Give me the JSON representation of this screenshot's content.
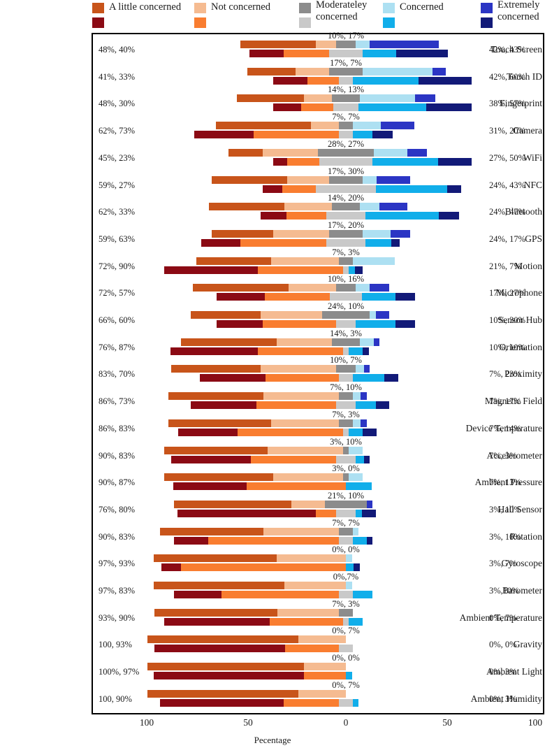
{
  "axis": {
    "xlabel": "Pecentage",
    "ticks": [
      "100",
      "50",
      "0",
      "50",
      "100"
    ]
  },
  "legend": {
    "items": [
      {
        "label": "A little concerned",
        "color_top": "#c8541a",
        "color_bottom": "#8b0a14"
      },
      {
        "label": "Not concerned",
        "color_top": "#f5bb91",
        "color_bottom": "#f97d30"
      },
      {
        "label": "Moderateley concerned",
        "color_top": "#8c8c8c",
        "color_bottom": "#c9c9c9"
      },
      {
        "label": "Concerned",
        "color_top": "#ade0f2",
        "color_bottom": "#11aeea"
      },
      {
        "label": "Extremely concerned",
        "color_top": "#2b35c4",
        "color_bottom": "#121a78"
      }
    ]
  },
  "chart_data": {
    "type": "bar",
    "title": "",
    "xlabel": "Pecentage",
    "ylabel": "",
    "xlim": [
      -100,
      100
    ],
    "grid": false,
    "legend_position": "top",
    "note": "Diverging stacked bars. Each category has two bars (series A = top, series B = bottom). Left label = sum of 'A little concerned' + 'Not concerned' for both series. Right label = sum of 'Concerned' + 'Extremely concerned' for both series. Center label above each pair = 'Moderateley concerned' for both series.",
    "series_names": [
      "Series A (top bar)",
      "Series B (bottom bar)"
    ],
    "segments": [
      "A little concerned",
      "Not concerned",
      "Moderateley concerned",
      "Concerned",
      "Extremely concerned"
    ],
    "categories": [
      "Touch Screen",
      "Touch ID",
      "Fingerprint",
      "Camera",
      "WiFi",
      "NFC",
      "Bluetooth",
      "GPS",
      "Motion",
      "Microphone",
      "Sensor  Hub",
      "Orientation",
      "Proximity",
      "Magnetic Field",
      "Device  Temperature",
      "Accelerometer",
      "Ambient Pressure",
      "Hall Sensor",
      "Rotation",
      "Gyroscope",
      "Barometer",
      "Ambient Temperature",
      "Gravity",
      "Ambient Light",
      "Ambient Humidity"
    ],
    "rows": [
      {
        "name": "Touch Screen",
        "left": "48%, 40%",
        "mid": "10%, 17%",
        "right": "42%, 43%",
        "a": [
          38,
          10,
          10,
          7,
          35
        ],
        "b": [
          17,
          23,
          17,
          17,
          26
        ]
      },
      {
        "name": "Touch ID",
        "left": "41%, 33%",
        "mid": "17%, 7%",
        "right": "42%, 60%",
        "a": [
          24,
          17,
          17,
          35,
          7
        ],
        "b": [
          17,
          16,
          7,
          33,
          27
        ]
      },
      {
        "name": "Fingerprint",
        "left": "48%, 30%",
        "mid": "14%, 13%",
        "right": "38%, 57%",
        "a": [
          34,
          14,
          14,
          28,
          10
        ],
        "b": [
          14,
          16,
          13,
          34,
          23
        ]
      },
      {
        "name": "Camera",
        "left": "62%, 73%",
        "mid": "7%, 7%",
        "right": "31%, 20%",
        "a": [
          48,
          14,
          7,
          14,
          17
        ],
        "b": [
          30,
          43,
          7,
          10,
          10
        ]
      },
      {
        "name": "WiFi",
        "left": "45%, 23%",
        "mid": "28%, 27%",
        "right": "27%, 50%",
        "a": [
          17,
          28,
          28,
          17,
          10
        ],
        "b": [
          7,
          16,
          27,
          33,
          17
        ]
      },
      {
        "name": "NFC",
        "left": "59%, 27%",
        "mid": "17%, 30%",
        "right": "24%, 43%",
        "a": [
          38,
          21,
          17,
          7,
          17
        ],
        "b": [
          10,
          17,
          30,
          36,
          7
        ]
      },
      {
        "name": "Bluetooth",
        "left": "62%, 33%",
        "mid": "14%, 20%",
        "right": "24%, 47%",
        "a": [
          38,
          24,
          14,
          10,
          14
        ],
        "b": [
          13,
          20,
          20,
          37,
          10
        ]
      },
      {
        "name": "GPS",
        "left": "59%, 63%",
        "mid": "17%, 20%",
        "right": "24%, 17%",
        "a": [
          31,
          28,
          17,
          14,
          10
        ],
        "b": [
          20,
          43,
          20,
          13,
          4
        ]
      },
      {
        "name": "Motion",
        "left": "72%, 90%",
        "mid": "7%, 3%",
        "right": "21%, 7%",
        "a": [
          38,
          34,
          7,
          21,
          0
        ],
        "b": [
          47,
          43,
          3,
          3,
          4
        ]
      },
      {
        "name": "Microphone",
        "left": "72%, 57%",
        "mid": "10%, 16%",
        "right": "17%, 27%",
        "a": [
          48,
          24,
          10,
          7,
          10
        ],
        "b": [
          24,
          33,
          16,
          17,
          10
        ]
      },
      {
        "name": "Sensor  Hub",
        "left": "66%, 60%",
        "mid": "24%, 10%",
        "right": "10%, 30%",
        "a": [
          35,
          31,
          24,
          3,
          7
        ],
        "b": [
          23,
          37,
          10,
          20,
          10
        ]
      },
      {
        "name": "Orientation",
        "left": "76%, 87%",
        "mid": "14%, 3%",
        "right": "10%, 10%",
        "a": [
          48,
          28,
          14,
          7,
          3
        ],
        "b": [
          44,
          43,
          3,
          7,
          3
        ]
      },
      {
        "name": "Proximity",
        "left": "83%, 70%",
        "mid": "10%, 7%",
        "right": "7%, 23%",
        "a": [
          45,
          38,
          10,
          4,
          3
        ],
        "b": [
          33,
          37,
          7,
          16,
          7
        ]
      },
      {
        "name": "Magnetic Field",
        "left": "86%, 73%",
        "mid": "7%, 10%",
        "right": "7%, 17%",
        "a": [
          48,
          38,
          7,
          4,
          3
        ],
        "b": [
          33,
          40,
          10,
          10,
          7
        ]
      },
      {
        "name": "Device  Temperature",
        "left": "86%, 83%",
        "mid": "7%, 3%",
        "right": "7%, 14%",
        "a": [
          52,
          34,
          7,
          4,
          3
        ],
        "b": [
          30,
          53,
          3,
          7,
          7
        ]
      },
      {
        "name": "Accelerometer",
        "left": "90%, 83%",
        "mid": "3%, 10%",
        "right": "7%, 3%",
        "a": [
          52,
          38,
          3,
          7,
          0
        ],
        "b": [
          40,
          43,
          10,
          4,
          3
        ]
      },
      {
        "name": "Ambient Pressure",
        "left": "90%, 87%",
        "mid": "3%, 0%",
        "right": "7%, 13%",
        "a": [
          55,
          35,
          3,
          7,
          0
        ],
        "b": [
          37,
          50,
          0,
          13,
          0
        ]
      },
      {
        "name": "Hall Sensor",
        "left": "76%, 80%",
        "mid": "21%, 10%",
        "right": "3%, 10%",
        "a": [
          59,
          17,
          21,
          0,
          3
        ],
        "b": [
          70,
          10,
          10,
          3,
          7
        ]
      },
      {
        "name": "Rotation",
        "left": "90%, 83%",
        "mid": "7%, 7%",
        "right": "3%, 10%",
        "a": [
          52,
          38,
          7,
          3,
          0
        ],
        "b": [
          17,
          66,
          7,
          7,
          3
        ]
      },
      {
        "name": "Gyroscope",
        "left": "97%, 93%",
        "mid": "0%, 0%",
        "right": "3%, 7%",
        "a": [
          62,
          35,
          0,
          3,
          0
        ],
        "b": [
          10,
          83,
          0,
          4,
          3
        ]
      },
      {
        "name": "Barometer",
        "left": "97%, 83%",
        "mid": "0%,7%",
        "right": "3%,10%",
        "a": [
          66,
          31,
          0,
          3,
          0
        ],
        "b": [
          24,
          59,
          7,
          10,
          0
        ]
      },
      {
        "name": "Ambient Temperature",
        "left": "93%, 90%",
        "mid": "7%, 3%",
        "right": "0%, 7%",
        "a": [
          62,
          31,
          7,
          0,
          0
        ],
        "b": [
          53,
          37,
          3,
          7,
          0
        ]
      },
      {
        "name": "Gravity",
        "left": "100, 93%",
        "mid": "0%, 7%",
        "right": "0%, 0%",
        "a": [
          76,
          24,
          0,
          0,
          0
        ],
        "b": [
          66,
          27,
          7,
          0,
          0
        ]
      },
      {
        "name": "Ambient Light",
        "left": "100%, 97%",
        "mid": "0%, 0%",
        "right": "0%, 3%",
        "a": [
          79,
          21,
          0,
          0,
          0
        ],
        "b": [
          76,
          21,
          0,
          3,
          0
        ]
      },
      {
        "name": "Ambient Humidity",
        "left": "100, 90%",
        "mid": "0%, 7%",
        "right": "0%, 3%",
        "a": [
          76,
          24,
          0,
          0,
          0
        ],
        "b": [
          62,
          28,
          7,
          3,
          0
        ]
      }
    ],
    "colors": {
      "a_little_top": "#c8541a",
      "a_little_bottom": "#8b0a14",
      "not_top": "#f5bb91",
      "not_bottom": "#f97d30",
      "mod_top": "#8c8c8c",
      "mod_bottom": "#c9c9c9",
      "conc_top": "#ade0f2",
      "conc_bottom": "#11aeea",
      "extr_top": "#2b35c4",
      "extr_bottom": "#121a78"
    }
  }
}
